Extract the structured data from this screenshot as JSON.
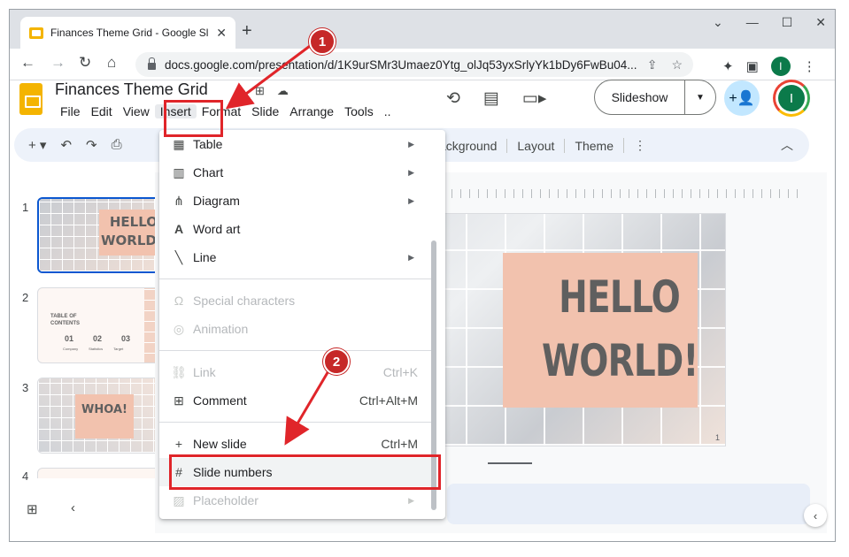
{
  "browser": {
    "tab_title": "Finances Theme Grid - Google Sli",
    "tab_close": "✕",
    "new_tab": "+",
    "url": "docs.google.com/presentation/d/1K9urSMr3Umaez0Ytg_olJq53yxSrlyYk1bDy6FwBu04...",
    "profile_initial": "I"
  },
  "app": {
    "doc_title": "Finances Theme Grid",
    "menu": [
      "File",
      "Edit",
      "View",
      "Insert",
      "Format",
      "Slide",
      "Arrange",
      "Tools"
    ],
    "slideshow_label": "Slideshow",
    "avatar_initial": "I"
  },
  "edit_toolbar": {
    "right_items": [
      "Background",
      "Layout",
      "Theme"
    ],
    "right_visible": [
      "ackground",
      "Layout",
      "Theme"
    ]
  },
  "filmstrip": {
    "numbers": [
      "1",
      "2",
      "3",
      "4"
    ],
    "thumb1_text": "HELLO WORLD!",
    "thumb2_title": "TABLE OF CONTENTS",
    "thumb2_nums": [
      "01",
      "02",
      "03"
    ],
    "thumb2_labels": [
      "Company",
      "Statistics",
      "Target"
    ],
    "thumb3_text": "WHOA!"
  },
  "slide": {
    "line1": "HELLO",
    "line2": "WORLD!",
    "number": "1"
  },
  "insert_menu": {
    "items": [
      {
        "label": "Table",
        "icon": "table-icon",
        "submenu": true,
        "enabled": true
      },
      {
        "label": "Chart",
        "icon": "chart-icon",
        "submenu": true,
        "enabled": true
      },
      {
        "label": "Diagram",
        "icon": "diagram-icon",
        "submenu": true,
        "enabled": true
      },
      {
        "label": "Word art",
        "icon": "word-art-icon",
        "submenu": false,
        "enabled": true
      },
      {
        "label": "Line",
        "icon": "line-icon",
        "submenu": true,
        "enabled": true
      },
      {
        "label": "Special characters",
        "icon": "omega-icon",
        "enabled": false
      },
      {
        "label": "Animation",
        "icon": "animation-icon",
        "enabled": false
      },
      {
        "label": "Link",
        "icon": "link-icon",
        "shortcut": "Ctrl+K",
        "enabled": false
      },
      {
        "label": "Comment",
        "icon": "comment-icon",
        "shortcut": "Ctrl+Alt+M",
        "enabled": true
      },
      {
        "label": "New slide",
        "icon": "plus-icon",
        "shortcut": "Ctrl+M",
        "enabled": true
      },
      {
        "label": "Slide numbers",
        "icon": "hash-icon",
        "enabled": true
      },
      {
        "label": "Placeholder",
        "icon": "placeholder-icon",
        "submenu": true,
        "enabled": false
      }
    ]
  },
  "annotations": {
    "step1": "1",
    "step2": "2",
    "highlight_color": "#e0252a",
    "badge_color": "#c62828"
  }
}
